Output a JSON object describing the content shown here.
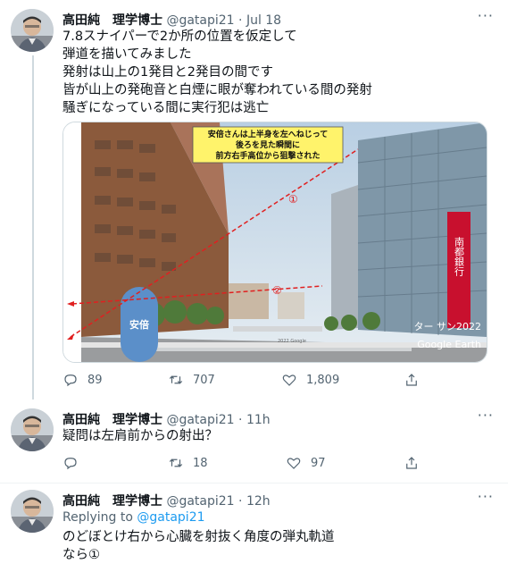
{
  "tweets": [
    {
      "name": "高田純　理学博士",
      "handle": "@gatapi21",
      "date": "Jul 18",
      "text": "7.8スナイパーで2か所の位置を仮定して\n弾道を描いてみました\n発射は山上の1発目と2発目の間です\n皆が山上の発砲音と白煙に眼が奪われている間の発射\n騒ぎになっている間に実行犯は逃亡",
      "media": {
        "callout_lines": [
          "安倍さんは上半身を左へねじって",
          "後ろを見た瞬間に",
          "前方右手高位から狙撃された"
        ],
        "marker1": "①",
        "marker2": "②",
        "person_label": "安倍",
        "credit": "ター サン2022",
        "watermark": "Google Earth",
        "building_sign": "南都銀行",
        "street_label": "2022 Google"
      },
      "stats": {
        "replies": "89",
        "retweets": "707",
        "likes": "1,809"
      }
    },
    {
      "name": "高田純　理学博士",
      "handle": "@gatapi21",
      "date": "11h",
      "text": "疑問は左肩前からの射出？",
      "stats": {
        "replies": "",
        "retweets": "18",
        "likes": "97"
      }
    },
    {
      "name": "高田純　理学博士",
      "handle": "@gatapi21",
      "date": "12h",
      "replying_prefix": "Replying to",
      "replying_to": "@gatapi21",
      "text": "のどぼとけ右から心臓を射抜く角度の弾丸軌道\nなら①"
    }
  ],
  "more_glyph": "···",
  "dot": "·"
}
